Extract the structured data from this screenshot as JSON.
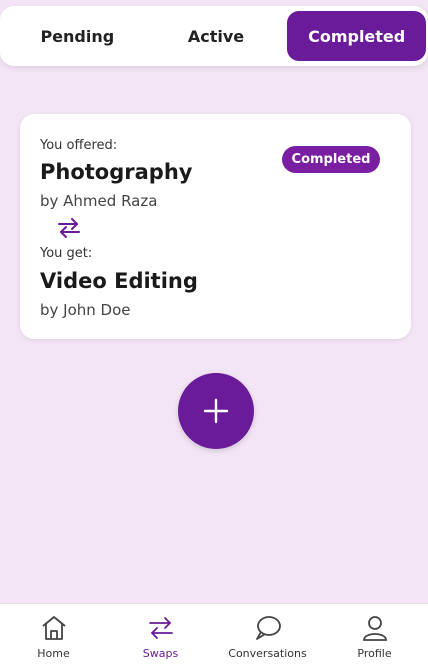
{
  "tabs": {
    "pending": "Pending",
    "active": "Active",
    "completed": "Completed"
  },
  "card": {
    "offered_caption": "You offered:",
    "offered_skill": "Photography",
    "offered_by": "by Ahmed Raza",
    "get_caption": "You get:",
    "get_skill": "Video Editing",
    "get_by": "by John Doe",
    "status": "Completed"
  },
  "fab": {
    "icon": "plus-icon"
  },
  "nav": {
    "home": "Home",
    "swaps": "Swaps",
    "conversations": "Conversations",
    "profile": "Profile"
  },
  "colors": {
    "accent": "#6a1b9a",
    "background": "#f3e5f5"
  }
}
